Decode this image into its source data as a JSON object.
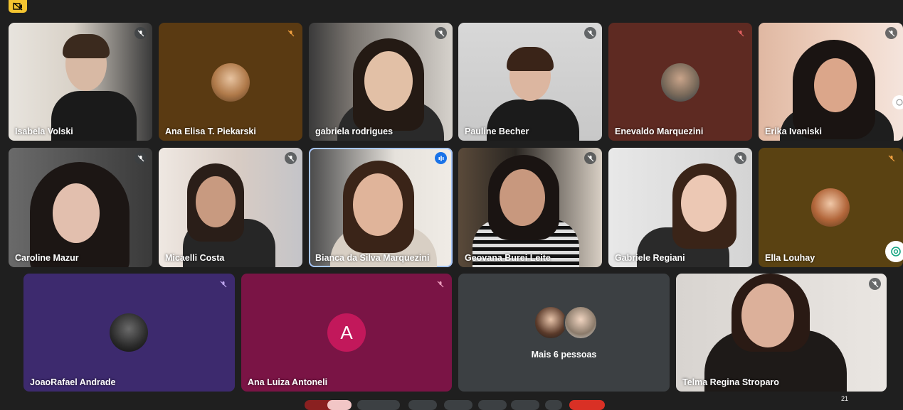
{
  "participants": [
    {
      "name": "Isabela Volski"
    },
    {
      "name": "Ana Elisa T. Piekarski"
    },
    {
      "name": "gabriela rodrigues"
    },
    {
      "name": "Pauline Becher"
    },
    {
      "name": "Enevaldo Marquezini"
    },
    {
      "name": "Erika Ivaniski"
    },
    {
      "name": "Caroline Mazur"
    },
    {
      "name": "Micaelli Costa"
    },
    {
      "name": "Bianca da Silva Marquezini"
    },
    {
      "name": "Geovana Burei Leite"
    },
    {
      "name": "Gabriele Regiani"
    },
    {
      "name": "Ella Louhay"
    },
    {
      "name": "JoaoRafael Andrade"
    },
    {
      "name": "Ana Luiza Antoneli",
      "initial": "A"
    },
    {
      "name": "Telma Regina Stroparo"
    }
  ],
  "more_tile": {
    "label": "Mais 6 pessoas"
  },
  "participant_count": "21",
  "colors": {
    "background": "#1f1f1f",
    "speaking_border": "#a8c7fa",
    "letter_avatar": "#c2185b",
    "accent": "#1a73e8"
  }
}
